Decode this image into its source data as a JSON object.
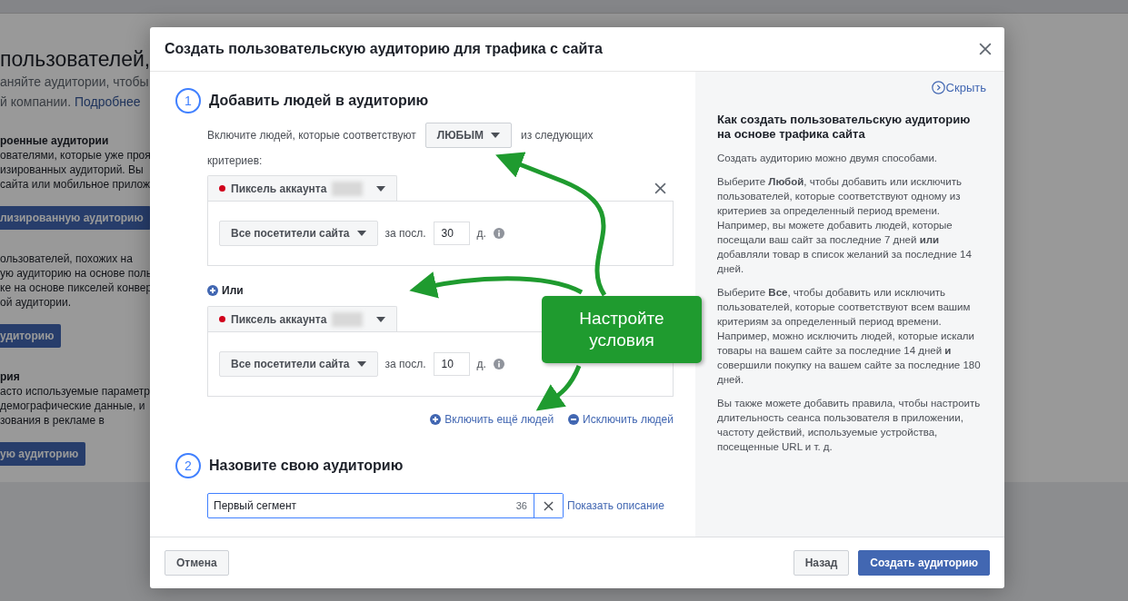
{
  "background_page": {
    "heading": "пользователей,",
    "intro_lines": [
      "аняйте аудитории, чтобы"
    ],
    "intro_last": "й компании.",
    "intro_link": "Подробнее",
    "sections": [
      {
        "title": "роенные аудитории",
        "lines": [
          "ователями, которые уже проя",
          "изированных аудиторий. Вы",
          "сайта или мобильное прилож"
        ],
        "button": "лизированную аудиторию"
      },
      {
        "lines": [
          "ользователей, похожих на",
          "ую аудиторию на основе поль",
          "ке на основе пикселей конвер",
          "ой аудитории."
        ],
        "button": "удиторию"
      },
      {
        "title": "рия",
        "lines": [
          "асто используемые параметр",
          "демографические данные, и",
          "зования в рекламе в"
        ],
        "button": "ую аудиторию"
      }
    ]
  },
  "modal": {
    "title": "Создать пользовательскую аудиторию для трафика с сайта",
    "step1": {
      "number": "1",
      "title": "Добавить людей в аудиторию",
      "include_prefix": "Включите людей, которые соответствуют",
      "match_dropdown": "ЛЮБЫМ",
      "include_suffix": "из следующих",
      "include_suffix_wrap": "критериев:",
      "rule_groups": [
        {
          "source": "Пиксель аккаунта",
          "event": "Все посетители сайта",
          "period_label": "за посл.",
          "days": "30",
          "days_unit": "д."
        },
        {
          "source": "Пиксель аккаунта",
          "event": "Все посетители сайта",
          "period_label": "за посл.",
          "days": "10",
          "days_unit": "д."
        }
      ],
      "or_label": "Или",
      "include_more": "Включить ещё людей",
      "exclude": "Исключить людей"
    },
    "step2": {
      "number": "2",
      "title": "Назовите свою аудиторию",
      "name_value": "Первый сегмент",
      "char_count": "36",
      "show_description": "Показать описание"
    },
    "help_panel": {
      "hide": "Скрыть",
      "title": "Как создать пользовательскую аудиторию на основе трафика сайта",
      "paragraphs": [
        "Создать аудиторию можно двумя способами.",
        "Выберите **Любой**, чтобы добавить или исключить пользователей, которые соответствуют одному из критериев за определенный период времени. Например, вы можете добавить людей, которые посещали ваш сайт за последние 7 дней **или** добавляли товар в список желаний за последние 14 дней.",
        "Выберите **Все**, чтобы добавить или исключить пользователей, которые соответствуют всем вашим критериям за определенный период времени. Например, можно исключить людей, которые искали товары на вашем сайте за последние 14 дней **и** совершили покупку на вашем сайте за последние 180 дней.",
        "Вы также можете добавить правила, чтобы настроить длительность сеанса пользователя в приложении, частоту действий, используемые устройства, посещенные URL и т. д."
      ]
    },
    "footer": {
      "cancel": "Отмена",
      "back": "Назад",
      "create": "Создать аудиторию"
    }
  },
  "annotation": {
    "text": "Настройте условия"
  }
}
